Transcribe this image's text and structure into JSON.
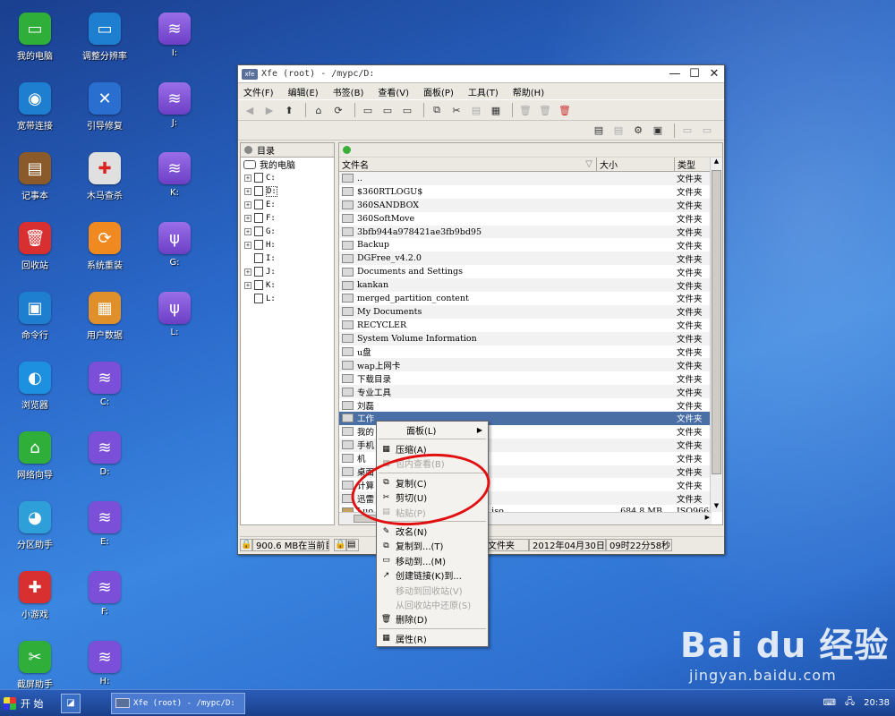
{
  "desktop": {
    "col1": [
      {
        "label": "我的电脑",
        "icon": "monitor-icon",
        "color": "#2fae3a"
      },
      {
        "label": "宽带连接",
        "icon": "globe-icon",
        "color": "#1e7fd0"
      },
      {
        "label": "记事本",
        "icon": "notebook-icon",
        "color": "#8a5a2a"
      },
      {
        "label": "回收站",
        "icon": "trash-icon",
        "color": "#d83030"
      },
      {
        "label": "命令行",
        "icon": "terminal-icon",
        "color": "#1e7fd0"
      },
      {
        "label": "浏览器",
        "icon": "browser-icon",
        "color": "#1e90e0"
      },
      {
        "label": "网络向导",
        "icon": "home-icon",
        "color": "#2fae3a"
      },
      {
        "label": "分区助手",
        "icon": "pie-icon",
        "color": "#2e9fd8"
      },
      {
        "label": "小游戏",
        "icon": "gamepad-icon",
        "color": "#d83030"
      },
      {
        "label": "截屏助手",
        "icon": "scissors-icon",
        "color": "#2fae3a"
      }
    ],
    "col2": [
      {
        "label": "调整分辨率",
        "icon": "display-icon",
        "color": "#1e7fd0"
      },
      {
        "label": "引导修复",
        "icon": "tools-icon",
        "color": "#2a6fd0"
      },
      {
        "label": "木马查杀",
        "icon": "medkit-icon",
        "color": "#e0e0e0"
      },
      {
        "label": "系统重装",
        "icon": "refresh-icon",
        "color": "#f08a20"
      },
      {
        "label": "用户数据",
        "icon": "box-icon",
        "color": "#e0902a"
      },
      {
        "label": "C:",
        "icon": "drive-icon",
        "color": "#7b4fd8"
      },
      {
        "label": "D:",
        "icon": "drive-icon",
        "color": "#7b4fd8"
      },
      {
        "label": "E:",
        "icon": "drive-icon",
        "color": "#7b4fd8"
      },
      {
        "label": "F:",
        "icon": "drive-icon",
        "color": "#7b4fd8"
      },
      {
        "label": "H:",
        "icon": "drive-icon",
        "color": "#7b4fd8"
      }
    ],
    "col3": [
      {
        "label": "I:",
        "icon": "drive-icon"
      },
      {
        "label": "J:",
        "icon": "drive-icon"
      },
      {
        "label": "K:",
        "icon": "drive-icon"
      },
      {
        "label": "G:",
        "icon": "usb-icon"
      },
      {
        "label": "L:",
        "icon": "usb-icon"
      }
    ]
  },
  "window": {
    "title": "Xfe (root) - /mypc/D:",
    "app_badge": "xfe",
    "menus": [
      "文件(F)",
      "编辑(E)",
      "书签(B)",
      "查看(V)",
      "面板(P)",
      "工具(T)",
      "帮助(H)"
    ],
    "tree": {
      "header": "目录",
      "root": "我的电脑",
      "drives": [
        "C:",
        "D:",
        "E:",
        "F:",
        "G:",
        "H:",
        "I:",
        "J:",
        "K:",
        "L:"
      ]
    },
    "columns": [
      "文件名",
      "大小",
      "类型"
    ],
    "files": [
      {
        "name": "..",
        "size": "",
        "type": "文件夹"
      },
      {
        "name": "$360RTLOGU$",
        "size": "",
        "type": "文件夹"
      },
      {
        "name": "360SANDBOX",
        "size": "",
        "type": "文件夹"
      },
      {
        "name": "360SoftMove",
        "size": "",
        "type": "文件夹"
      },
      {
        "name": "3bfb944a978421ae3fb9bd95",
        "size": "",
        "type": "文件夹"
      },
      {
        "name": "Backup",
        "size": "",
        "type": "文件夹"
      },
      {
        "name": "DGFree_v4.2.0",
        "size": "",
        "type": "文件夹"
      },
      {
        "name": "Documents and Settings",
        "size": "",
        "type": "文件夹"
      },
      {
        "name": "kankan",
        "size": "",
        "type": "文件夹"
      },
      {
        "name": "merged_partition_content",
        "size": "",
        "type": "文件夹"
      },
      {
        "name": "My Documents",
        "size": "",
        "type": "文件夹"
      },
      {
        "name": "RECYCLER",
        "size": "",
        "type": "文件夹"
      },
      {
        "name": "System Volume Information",
        "size": "",
        "type": "文件夹"
      },
      {
        "name": "u盘",
        "size": "",
        "type": "文件夹"
      },
      {
        "name": "wap上网卡",
        "size": "",
        "type": "文件夹"
      },
      {
        "name": "下载目录",
        "size": "",
        "type": "文件夹"
      },
      {
        "name": "专业工具",
        "size": "",
        "type": "文件夹"
      },
      {
        "name": "刘磊",
        "size": "",
        "type": "文件夹"
      },
      {
        "name": "工作",
        "size": "",
        "type": "文件夹"
      },
      {
        "name": "我的",
        "size": "",
        "type": "文件夹"
      },
      {
        "name": "手机",
        "size": "",
        "type": "文件夹"
      },
      {
        "name": "机",
        "size": "",
        "type": "文件夹"
      },
      {
        "name": "桌面",
        "size": "",
        "type": "文件夹"
      },
      {
        "name": "计算",
        "size": "",
        "type": "文件夹"
      },
      {
        "name": "迅雷",
        "size": "",
        "type": "文件夹"
      },
      {
        "name": "Luo",
        "name_tail": "iso",
        "size": "684.8 MB",
        "type": "ISO9660"
      }
    ],
    "selected_index": 18,
    "status": {
      "left": "900.6 MB在当前目",
      "middle": "目中",
      "type": "文件夹",
      "date": "2012年04月30日",
      "time": "09时22分58秒"
    }
  },
  "context_menu": {
    "items": [
      {
        "label": "面板(L)",
        "icon": "",
        "disabled": false,
        "submenu": true
      },
      {
        "sep": true
      },
      {
        "label": "压缩(A)",
        "icon": "archive-icon",
        "disabled": false
      },
      {
        "label": "包内查看(B)",
        "icon": "archive-view-icon",
        "disabled": true
      },
      {
        "sep": true
      },
      {
        "label": "复制(C)",
        "icon": "copy-icon",
        "disabled": false
      },
      {
        "label": "剪切(U)",
        "icon": "cut-icon",
        "disabled": false
      },
      {
        "label": "粘贴(P)",
        "icon": "paste-icon",
        "disabled": true
      },
      {
        "sep": true
      },
      {
        "label": "改名(N)",
        "icon": "rename-icon",
        "disabled": false
      },
      {
        "label": "复制到...(T)",
        "icon": "copy-to-icon",
        "disabled": false
      },
      {
        "label": "移动到...(M)",
        "icon": "move-to-icon",
        "disabled": false
      },
      {
        "label": "创建链接(K)到...",
        "icon": "link-icon",
        "disabled": false
      },
      {
        "label": "移动到回收站(V)",
        "icon": "",
        "disabled": true
      },
      {
        "label": "从回收站中还原(S)",
        "icon": "",
        "disabled": true
      },
      {
        "label": "删除(D)",
        "icon": "delete-icon",
        "disabled": false
      },
      {
        "sep": true
      },
      {
        "label": "属性(R)",
        "icon": "properties-icon",
        "disabled": false
      }
    ]
  },
  "taskbar": {
    "start_label": "开 始",
    "task_label": "Xfe (root) - /mypc/D:",
    "clock": "20:38"
  },
  "watermark": {
    "brand": "Bai du 经验",
    "url": "jingyan.baidu.com"
  }
}
